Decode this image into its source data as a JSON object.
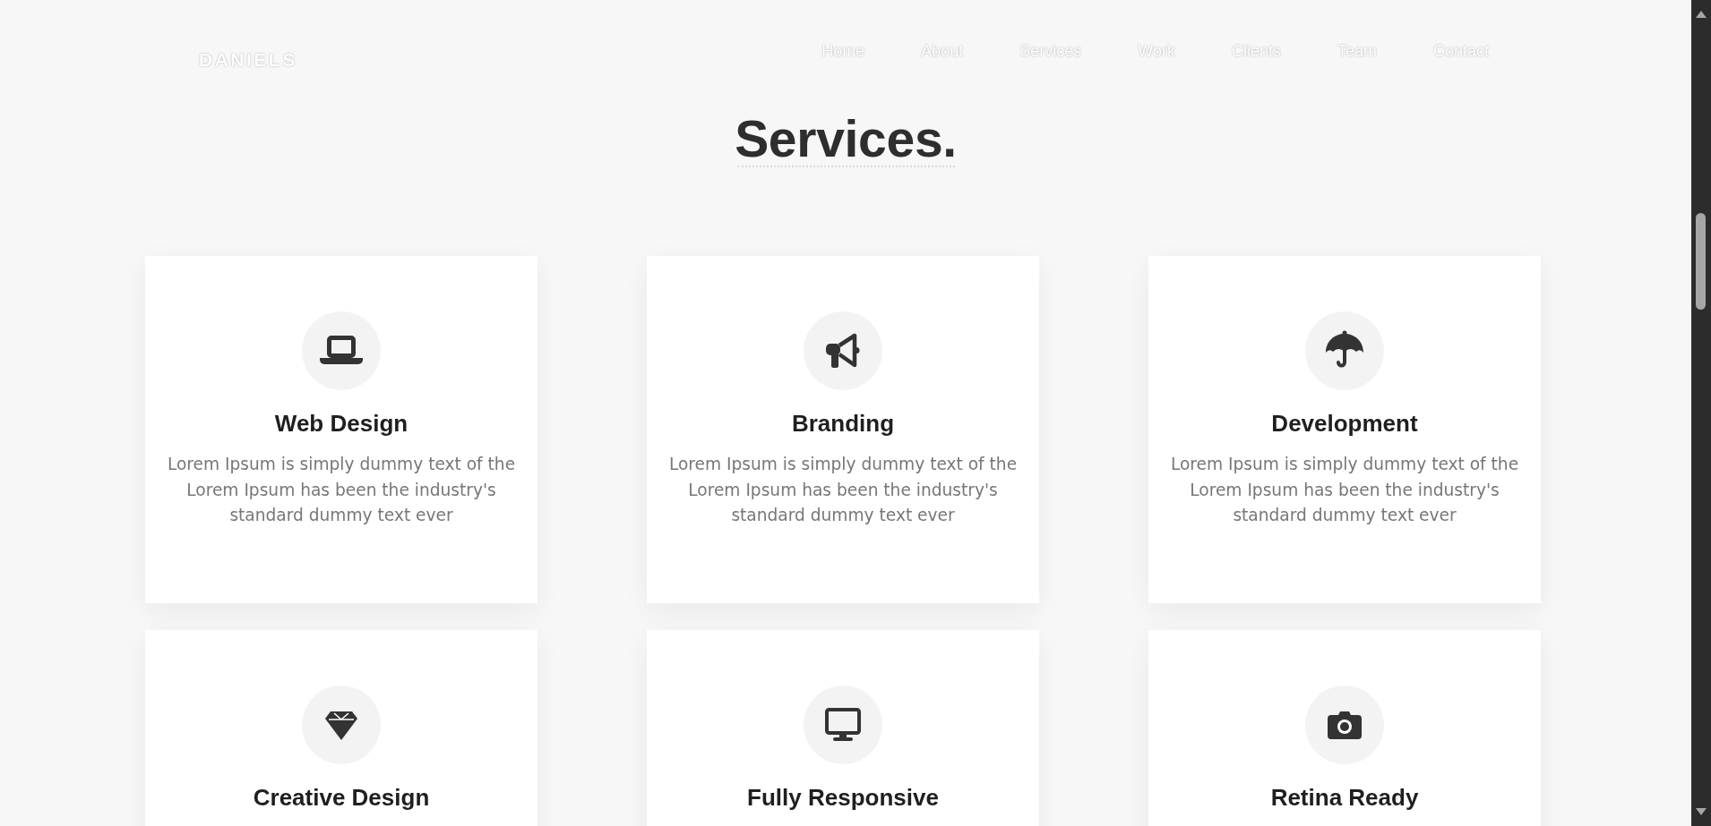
{
  "header": {
    "logo": "DANIELS",
    "nav": [
      {
        "label": "Home"
      },
      {
        "label": "About"
      },
      {
        "label": "Services"
      },
      {
        "label": "Work"
      },
      {
        "label": "Clients"
      },
      {
        "label": "Team"
      },
      {
        "label": "Contact"
      }
    ]
  },
  "section": {
    "title": "Services."
  },
  "services": [
    {
      "kind": "laptop",
      "title": "Web Design",
      "description": "Lorem Ipsum is simply dummy text of the Lorem Ipsum has been the industry's standard dummy text ever"
    },
    {
      "kind": "megaphone",
      "title": "Branding",
      "description": "Lorem Ipsum is simply dummy text of the Lorem Ipsum has been the industry's standard dummy text ever"
    },
    {
      "kind": "umbrella",
      "title": "Development",
      "description": "Lorem Ipsum is simply dummy text of the Lorem Ipsum has been the industry's standard dummy text ever"
    },
    {
      "kind": "gem",
      "title": "Creative Design"
    },
    {
      "kind": "monitor",
      "title": "Fully Responsive"
    },
    {
      "kind": "camera",
      "title": "Retina Ready"
    }
  ]
}
